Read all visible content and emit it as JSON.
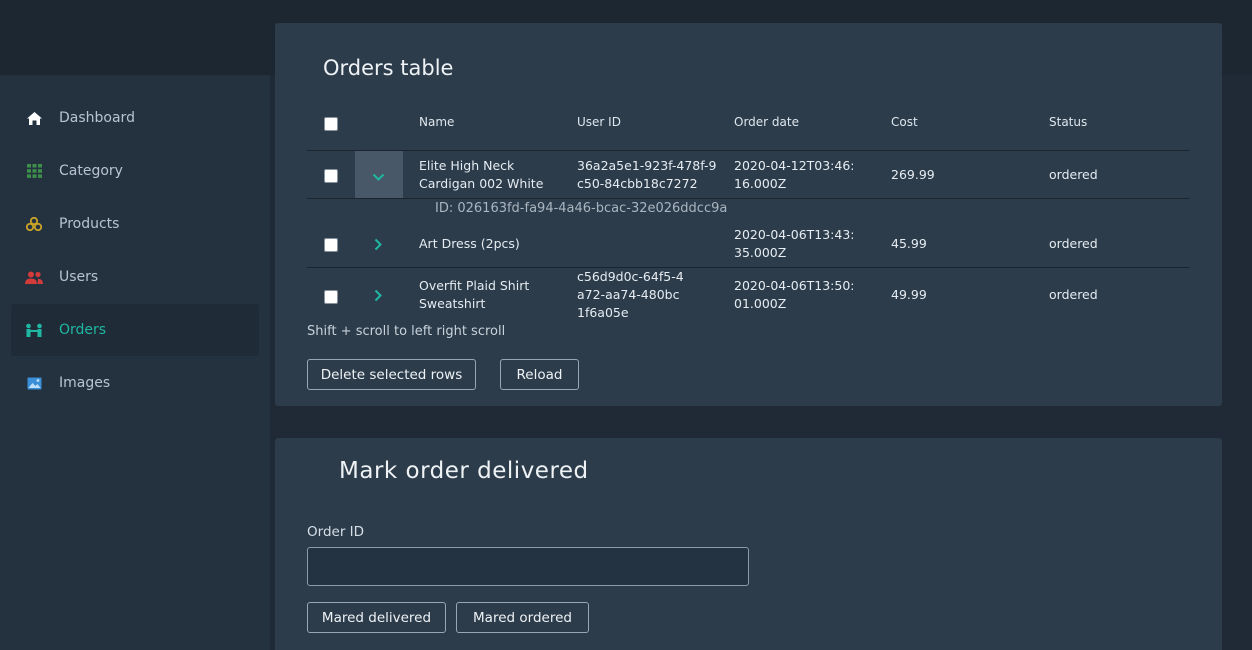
{
  "sidebar": {
    "items": [
      {
        "label": "Dashboard",
        "icon": "home-icon",
        "color": "#ffffff"
      },
      {
        "label": "Category",
        "icon": "grid-icon",
        "color": "#3d8f4a"
      },
      {
        "label": "Products",
        "icon": "boxes-icon",
        "color": "#c9a227"
      },
      {
        "label": "Users",
        "icon": "users-icon",
        "color": "#d33a3a"
      },
      {
        "label": "Orders",
        "icon": "orders-icon",
        "color": "#1fb8a3"
      },
      {
        "label": "Images",
        "icon": "image-icon",
        "color": "#3a8fd6"
      }
    ],
    "active": "Orders"
  },
  "orders": {
    "title": "Orders table",
    "columns": {
      "name": "Name",
      "user_id": "User ID",
      "order_date": "Order date",
      "cost": "Cost",
      "status": "Status"
    },
    "rows": [
      {
        "name": "Elite High Neck Cardigan 002 White",
        "user_id": "36a2a5e1-923f-478f-9c50-84cbb18c7272",
        "order_date": "2020-04-12T03:46:16.000Z",
        "cost": "269.99",
        "status": "ordered",
        "expanded": true,
        "detail": "ID: 026163fd-fa94-4a46-bcac-32e026ddcc9a"
      },
      {
        "name": "Art Dress (2pcs)",
        "user_id": "",
        "order_date": "2020-04-06T13:43:35.000Z",
        "cost": "45.99",
        "status": "ordered",
        "expanded": false
      },
      {
        "name": "Overfit Plaid Shirt Sweatshirt",
        "user_id": "c56d9d0c-64f5-4a72-aa74-480bc1f6a05e",
        "order_date": "2020-04-06T13:50:01.000Z",
        "cost": "49.99",
        "status": "ordered",
        "expanded": false
      }
    ],
    "hint": "Shift + scroll to left right scroll",
    "delete_label": "Delete selected rows",
    "reload_label": "Reload"
  },
  "mark": {
    "title": "Mark order delivered",
    "field_label": "Order ID",
    "field_value": "",
    "delivered_label": "Mared delivered",
    "ordered_label": "Mared ordered"
  },
  "colors": {
    "accent": "#1fb8a3",
    "card": "#2c3c4b",
    "background": "#1f2a36"
  }
}
